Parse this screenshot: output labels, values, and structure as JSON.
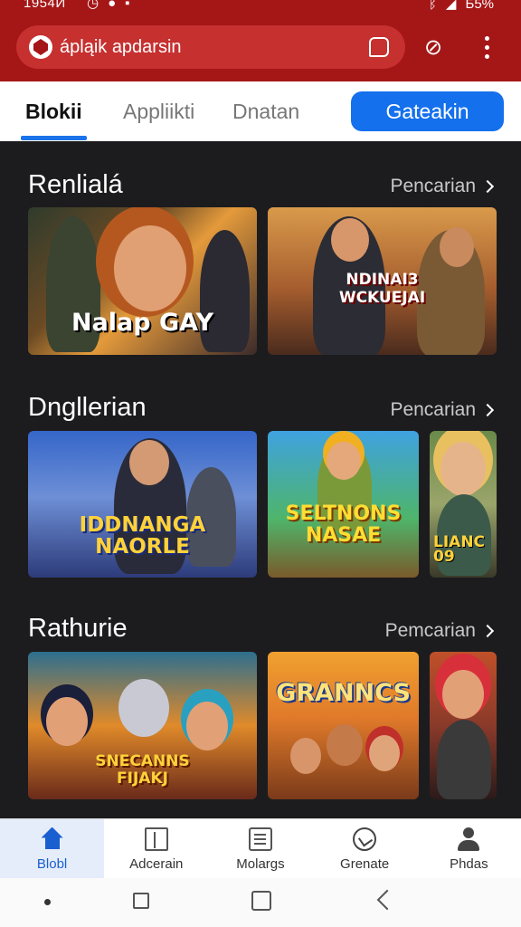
{
  "status_bar": {
    "time": "1954Й",
    "battery": "Б5%"
  },
  "browser": {
    "url_text": "ápląik apdarsin"
  },
  "tabs": [
    {
      "label": "Blokii",
      "active": true
    },
    {
      "label": "Appliikti",
      "active": false
    },
    {
      "label": "Dnatan",
      "active": false
    }
  ],
  "cta_button": "Gateakin",
  "sections": [
    {
      "title": "Renlialá",
      "more": "Pencarian",
      "cards": [
        {
          "title": "Nalap GAY"
        },
        {
          "title": "NDINAI3 WCKUEJAI"
        }
      ]
    },
    {
      "title": "Dngllerian",
      "more": "Pencarian",
      "cards": [
        {
          "title": "IDDNANGA NAORLE"
        },
        {
          "title": "SELTNONS NASAE"
        },
        {
          "title": "LIANC 09"
        }
      ]
    },
    {
      "title": "Rathurie",
      "more": "Pemcarian",
      "cards": [
        {
          "title": "SNECANNS FIJAKJ"
        },
        {
          "title": "GRANNCS"
        },
        {
          "title": ""
        }
      ]
    }
  ],
  "bottom_nav": [
    {
      "label": "Blobl",
      "icon": "home-icon",
      "active": true
    },
    {
      "label": "Adcerain",
      "icon": "bars-icon",
      "active": false
    },
    {
      "label": "Molargs",
      "icon": "tray-icon",
      "active": false
    },
    {
      "label": "Grenate",
      "icon": "chat-icon",
      "active": false
    },
    {
      "label": "Phdas",
      "icon": "person-icon",
      "active": false
    }
  ],
  "colors": {
    "header": "#a51617",
    "accent": "#1470ec",
    "content_bg": "#1c1c1e"
  }
}
